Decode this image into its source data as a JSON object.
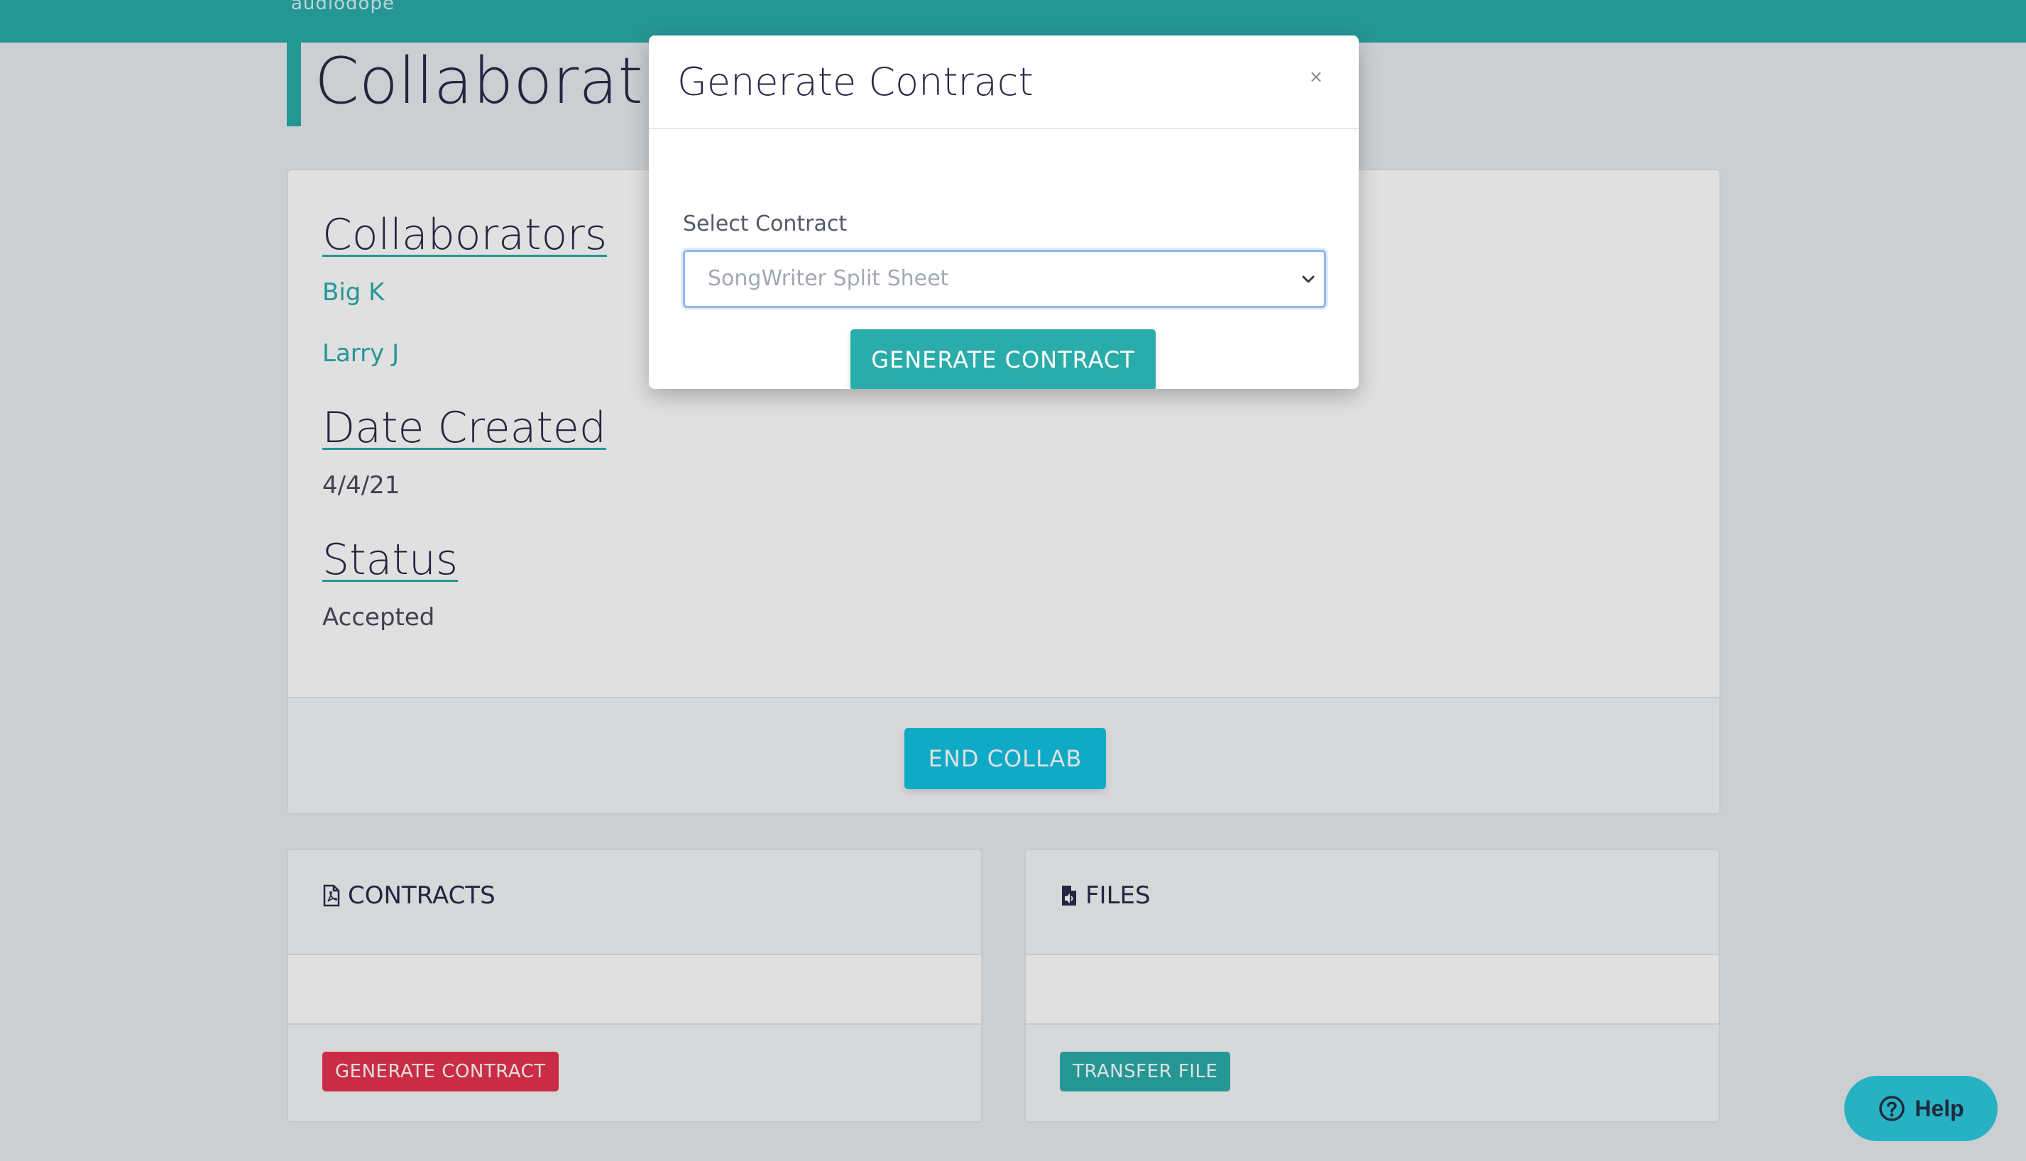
{
  "nav": {
    "brand": "audiodope"
  },
  "page": {
    "title": "Collaborati"
  },
  "collaboration": {
    "collaborators_heading": "Collaborators",
    "collaborators": [
      "Big K",
      "Larry J"
    ],
    "date_created_heading": "Date Created",
    "date_created": "4/4/21",
    "status_heading": "Status",
    "status": "Accepted",
    "end_button": "END COLLAB"
  },
  "contracts": {
    "title": "CONTRACTS",
    "button": "GENERATE CONTRACT",
    "icon": "file-pdf-icon"
  },
  "files": {
    "title": "FILES",
    "button": "TRANSFER FILE",
    "icon": "file-audio-icon"
  },
  "modal": {
    "title": "Generate Contract",
    "close": "×",
    "select_label": "Select Contract",
    "selected_contract": "SongWriter Split Sheet",
    "submit": "GENERATE CONTRACT"
  },
  "help": {
    "label": "Help",
    "icon": "question-circle-icon"
  },
  "colors": {
    "brand": "#2aacaa",
    "accent_cyan": "#11c2e2",
    "danger": "#e8334f"
  }
}
